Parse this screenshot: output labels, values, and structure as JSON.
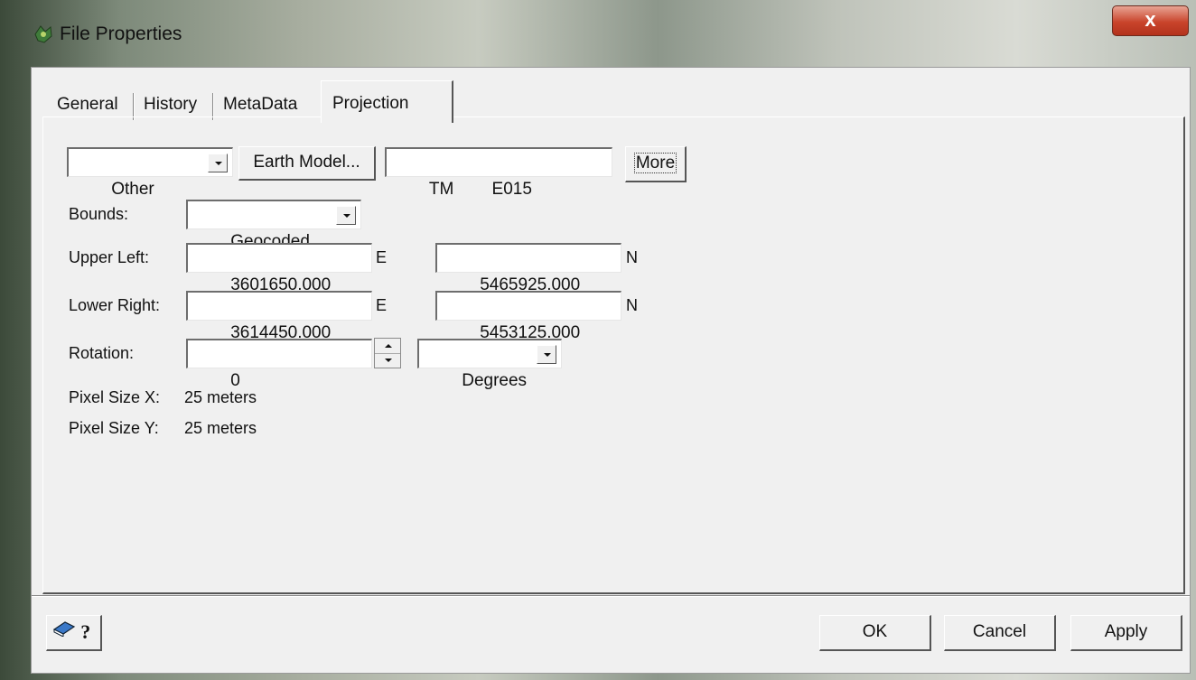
{
  "window": {
    "title": "File Properties",
    "close_label": "x"
  },
  "tabs": [
    {
      "label": "General"
    },
    {
      "label": "History"
    },
    {
      "label": "MetaData"
    },
    {
      "label": "Projection"
    }
  ],
  "projection": {
    "type_select": "Other",
    "earth_model_label": "Earth Model...",
    "projection_name": "TM        E015",
    "more_label": "More"
  },
  "bounds": {
    "label": "Bounds:",
    "value": "Geocoded"
  },
  "upper_left": {
    "label": "Upper Left:",
    "easting": "3601650.000",
    "e_unit": "E",
    "northing": "5465925.000",
    "n_unit": "N"
  },
  "lower_right": {
    "label": "Lower Right:",
    "easting": "3614450.000",
    "e_unit": "E",
    "northing": "5453125.000",
    "n_unit": "N"
  },
  "rotation": {
    "label": "Rotation:",
    "value": "0",
    "unit": "Degrees"
  },
  "pixel_size": {
    "x_label": "Pixel Size X:",
    "x_value": "25 meters",
    "y_label": "Pixel Size Y:",
    "y_value": "25 meters"
  },
  "help_label": "?",
  "footer": {
    "ok_label": "OK",
    "cancel_label": "Cancel",
    "apply_label": "Apply"
  },
  "colors": {
    "close_button": "#c9442b",
    "dialog_bg": "#f0f0f0"
  }
}
